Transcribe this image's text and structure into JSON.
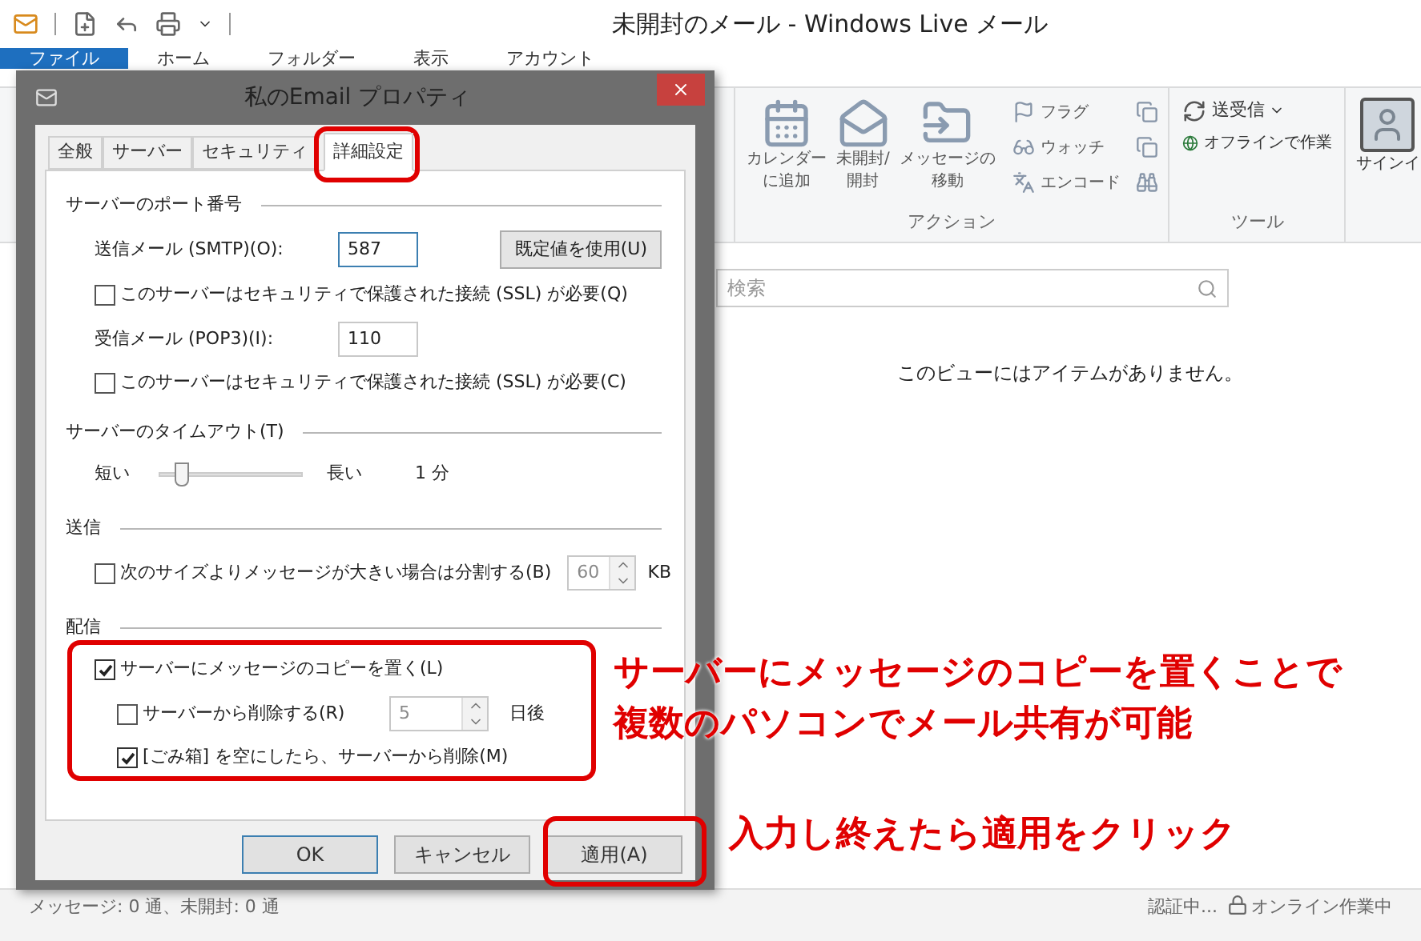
{
  "window": {
    "title": "未開封のメール - Windows Live メール"
  },
  "ribbon_tabs": [
    {
      "label": "ファイル",
      "selected": true
    },
    {
      "label": "ホーム",
      "selected": false
    },
    {
      "label": "フォルダー",
      "selected": false
    },
    {
      "label": "表示",
      "selected": false
    },
    {
      "label": "アカウント",
      "selected": false
    }
  ],
  "actions_group": {
    "label": "アクション",
    "large_items": [
      {
        "kind": "calendar",
        "lines": [
          "カレンダー",
          "に追加"
        ]
      },
      {
        "kind": "envelope",
        "lines": [
          "未開封/",
          "開封"
        ]
      },
      {
        "kind": "move",
        "lines": [
          "メッセージの",
          "移動"
        ]
      }
    ],
    "small_items": [
      {
        "kind": "flag",
        "label": "フラグ"
      },
      {
        "kind": "watch",
        "label": "ウォッチ"
      },
      {
        "kind": "encode",
        "label": "エンコード"
      }
    ]
  },
  "tools_group": {
    "label": "ツール",
    "send_receive": "送受信",
    "offline": "オフラインで作業"
  },
  "sign_in": "サインイ",
  "search": {
    "placeholder": "検索"
  },
  "empty_message": "このビューにはアイテムがありません。",
  "status_bar": {
    "counts": "メッセージ: 0 通、未開封: 0 通",
    "auth": "認証中...",
    "connection": "オンライン作業中"
  },
  "dialog": {
    "title": "私のEmail プロパティ",
    "tabs": [
      {
        "label": "全般",
        "selected": false
      },
      {
        "label": "サーバー",
        "selected": false
      },
      {
        "label": "セキュリティ",
        "selected": false
      },
      {
        "label": "詳細設定",
        "selected": true
      }
    ],
    "port": {
      "heading": "サーバーのポート番号",
      "smtp": {
        "label": "送信メール (SMTP)(O):",
        "value": "587",
        "focused": true
      },
      "default_button": "既定値を使用(U)",
      "smtp_ssl": {
        "label": "このサーバーはセキュリティで保護された接続 (SSL) が必要(Q)",
        "checked": false
      },
      "pop3": {
        "label": "受信メール (POP3)(I):",
        "value": "110",
        "focused": false
      },
      "pop3_ssl": {
        "label": "このサーバーはセキュリティで保護された接続 (SSL) が必要(C)",
        "checked": false
      }
    },
    "timeout": {
      "heading": "サーバーのタイムアウト(T)",
      "short_label": "短い",
      "long_label": "長い",
      "level": 0.15,
      "reading": "1 分"
    },
    "send": {
      "heading": "送信",
      "split": {
        "label": "次のサイズよりメッセージが大きい場合は分割する(B)",
        "checked": false
      },
      "size": {
        "value": "60",
        "disabled": true
      },
      "unit": "KB"
    },
    "delivery": {
      "heading": "配信",
      "keep_copy": {
        "label": "サーバーにメッセージのコピーを置く(L)",
        "checked": true
      },
      "delete_after": {
        "label": "サーバーから削除する(R)",
        "checked": false
      },
      "days": {
        "value": "5",
        "disabled": true
      },
      "days_unit": "日後",
      "delete_on_empty": {
        "label": "[ごみ箱] を空にしたら、サーバーから削除(M)",
        "checked": true
      }
    },
    "buttons": [
      {
        "label": "OK",
        "kind": "default"
      },
      {
        "label": "キャンセル",
        "kind": "normal"
      },
      {
        "label": "適用(A)",
        "kind": "normal"
      }
    ]
  },
  "annotations": [
    {
      "text": "サーバーにメッセージのコピーを置くことで"
    },
    {
      "text": "複数のパソコンでメール共有が可能"
    },
    {
      "text": "入力し終えたら適用をクリック"
    }
  ]
}
